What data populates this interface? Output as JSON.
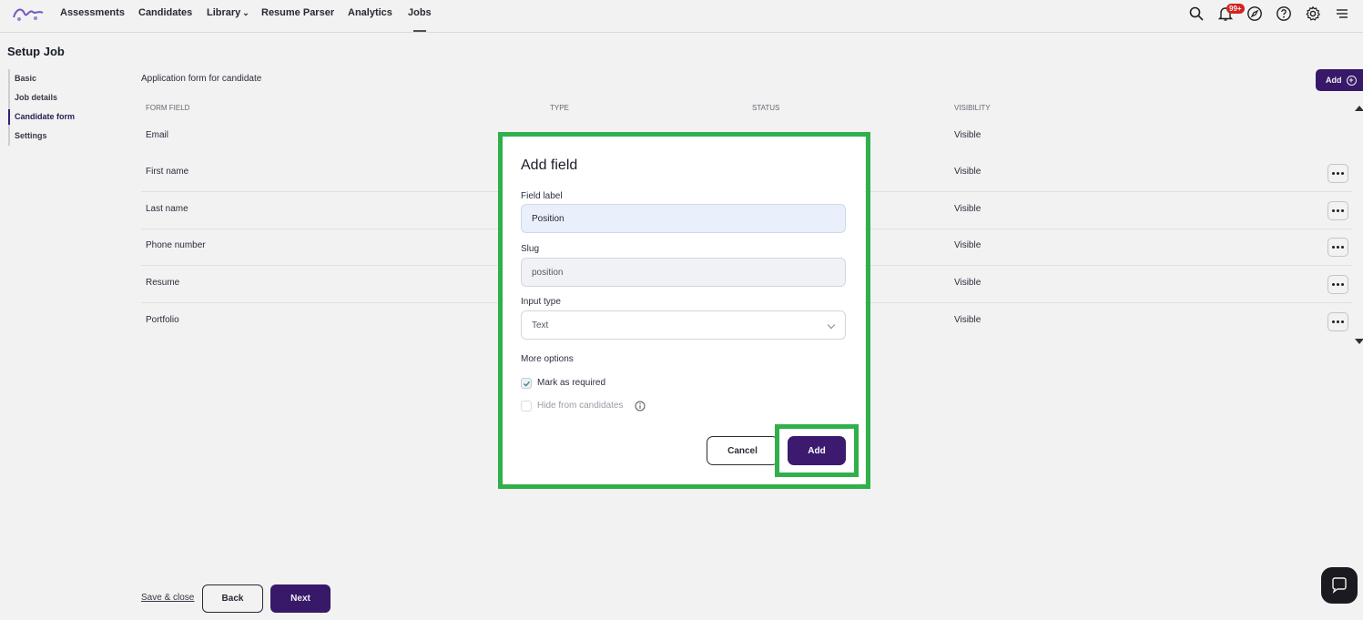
{
  "nav": {
    "items": [
      "Assessments",
      "Candidates",
      "Library",
      "Resume Parser",
      "Analytics",
      "Jobs"
    ],
    "notification_badge": "99+",
    "icons": [
      "search-icon",
      "bell-icon",
      "compass-icon",
      "help-icon",
      "gear-icon",
      "menu-icon"
    ]
  },
  "page": {
    "title": "Setup Job",
    "sidebar": [
      "Basic",
      "Job details",
      "Candidate form",
      "Settings"
    ],
    "active_step": "Candidate form"
  },
  "form": {
    "heading": "Application form for candidate",
    "add_label": "Add",
    "columns": [
      "FORM FIELD",
      "TYPE",
      "STATUS",
      "VISIBILITY"
    ],
    "rows": [
      {
        "field": "Email",
        "visibility": "Visible"
      },
      {
        "field": "First name",
        "visibility": "Visible"
      },
      {
        "field": "Last name",
        "visibility": "Visible"
      },
      {
        "field": "Phone number",
        "visibility": "Visible"
      },
      {
        "field": "Resume",
        "visibility": "Visible"
      },
      {
        "field": "Portfolio",
        "visibility": "Visible"
      }
    ]
  },
  "footer": {
    "save_close": "Save & close",
    "back": "Back",
    "next": "Next"
  },
  "modal": {
    "title": "Add field",
    "field_label_label": "Field label",
    "field_label_value": "Position",
    "slug_label": "Slug",
    "slug_value": "position",
    "input_type_label": "Input type",
    "input_type_value": "Text",
    "more_options_label": "More options",
    "required_label": "Mark as required",
    "required_checked": true,
    "hide_label": "Hide from candidates",
    "hide_checked": false,
    "cancel_label": "Cancel",
    "add_label": "Add"
  },
  "colors": {
    "brand": "#3b1a6f",
    "highlight": "#2fb04a",
    "badge": "#e02424"
  }
}
